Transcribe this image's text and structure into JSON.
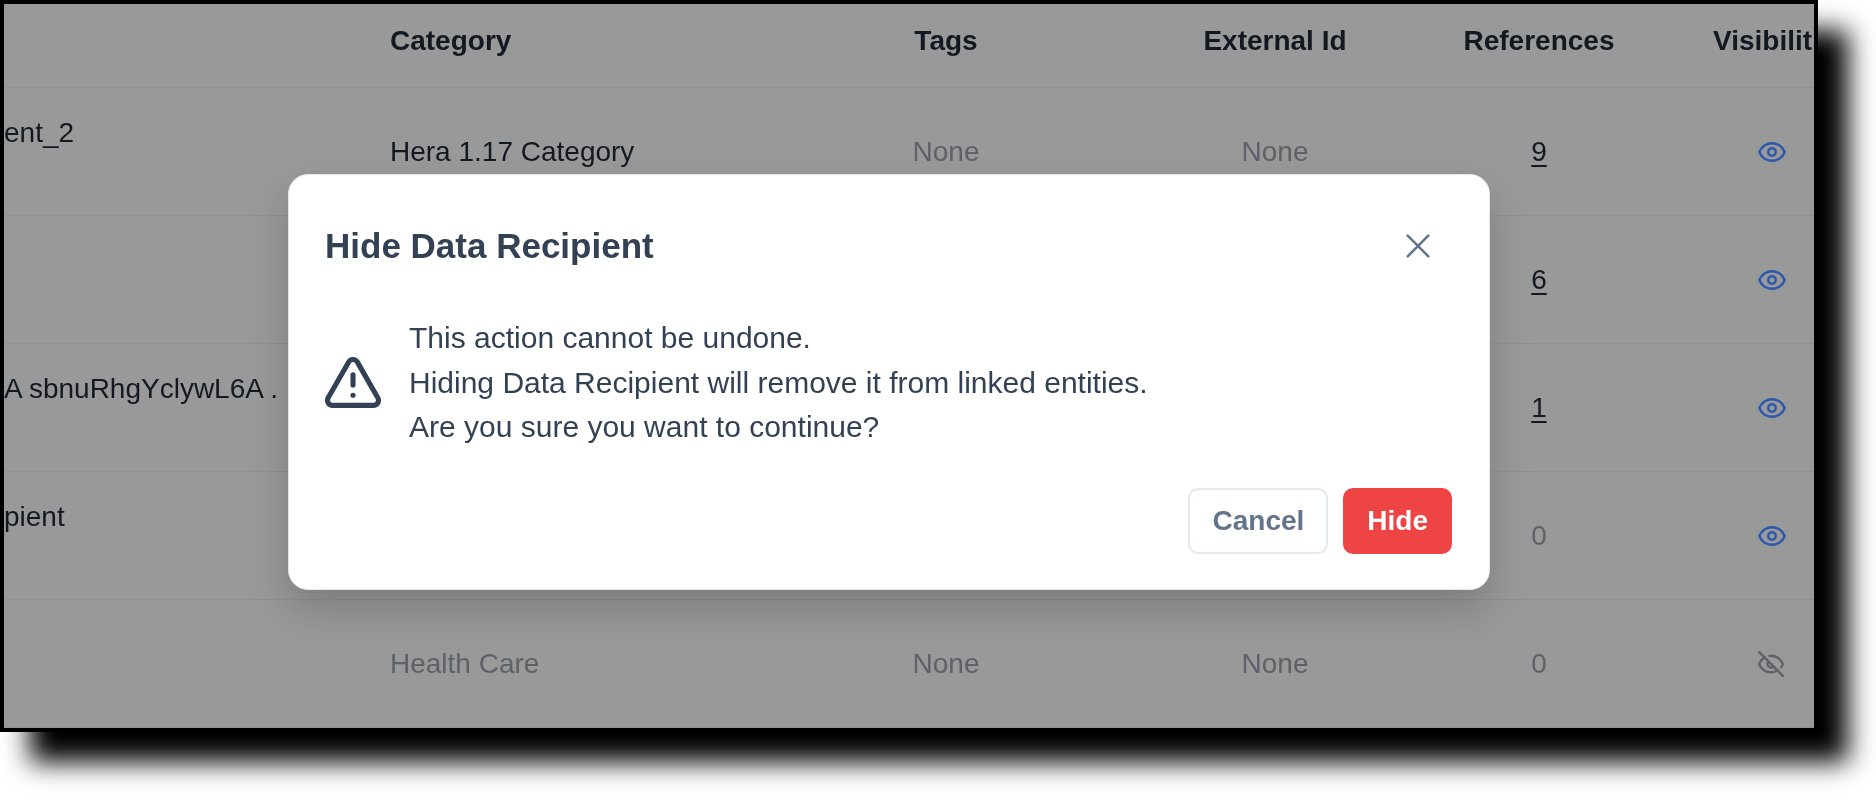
{
  "table": {
    "columns": [
      "Category",
      "Tags",
      "External Id",
      "References",
      "Visibilit"
    ],
    "rows": [
      {
        "column_1": "ent_2",
        "category": "Hera 1.17 Category",
        "tags": "None",
        "external_id": "None",
        "references": "9",
        "linked": true,
        "visible": true
      },
      {
        "references": "6",
        "linked": true,
        "visible": true
      },
      {
        "column_1": "A sbnuRhgYclywL6A .",
        "references": "1",
        "linked": true,
        "visible": true
      },
      {
        "column_1": "pient",
        "references": "0",
        "linked": false,
        "visible": true
      },
      {
        "category": "Health Care",
        "tags": "None",
        "external_id": "None",
        "references": "0",
        "linked": false,
        "visible": false
      }
    ]
  },
  "dialog": {
    "title": "Hide Data Recipient",
    "messages": [
      "This action cannot be undone.",
      "Hiding Data Recipient will remove it from linked entities.",
      "Are you sure you want to continue?"
    ],
    "buttons": [
      {
        "label": "Cancel",
        "kind": "cancel"
      },
      {
        "label": "Hide",
        "kind": "danger"
      }
    ]
  }
}
